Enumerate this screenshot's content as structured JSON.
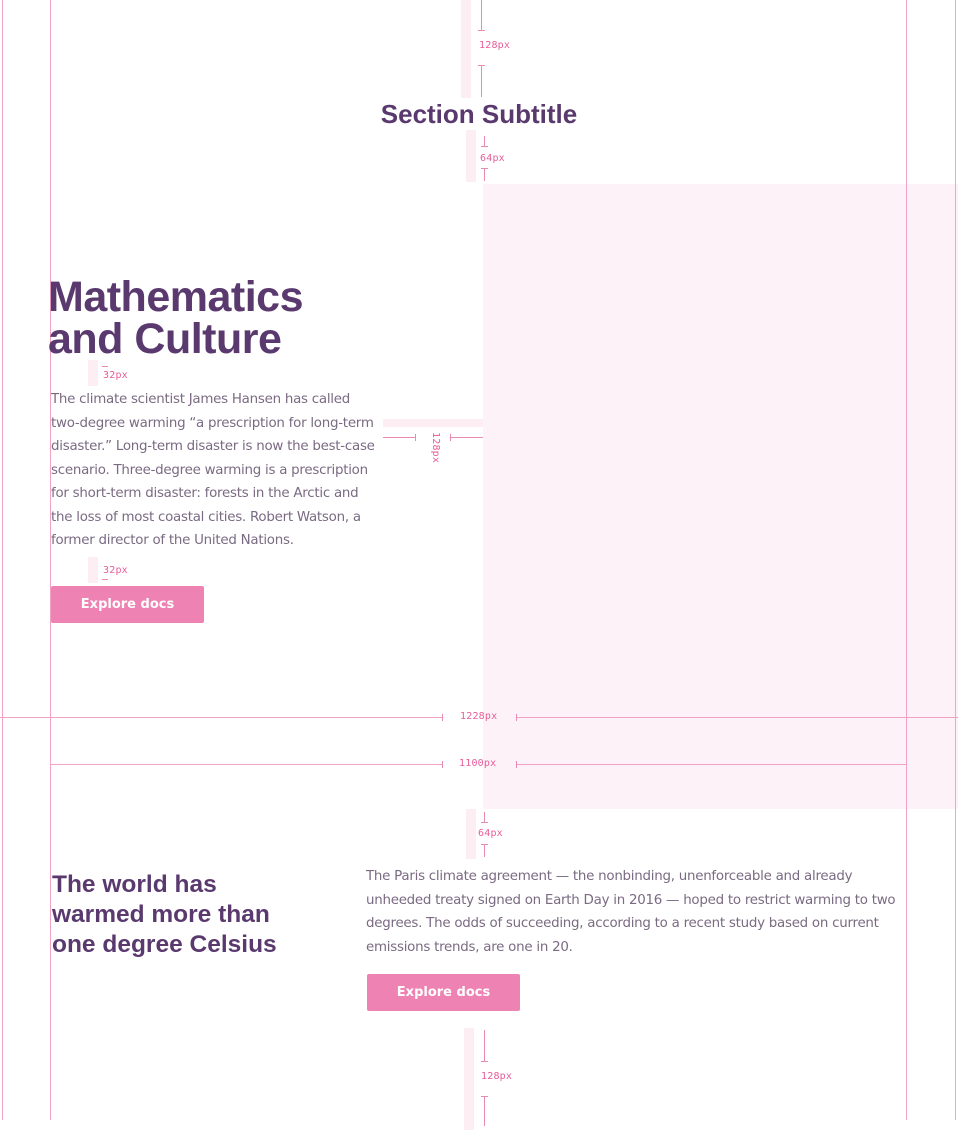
{
  "top_section": {
    "spacing_top_label": "128px",
    "subtitle": "Section Subtitle",
    "spacing_below_subtitle_label": "64px"
  },
  "hero": {
    "title_line1": "Mathematics",
    "title_line2": "and Culture",
    "spacing_after_title_label": "32px",
    "paragraph_lines": [
      "The climate scientist James Hansen has called",
      "two-degree warming “a prescription for long-term",
      "disaster.” Long-term disaster is now the best-case",
      "scenario. Three-degree warming is a prescription",
      "for short-term disaster: forests in the Arctic and",
      "the loss of most coastal cities. Robert Watson, a",
      "former director of the United Nations."
    ],
    "spacing_after_paragraph_label": "32px",
    "button_label": "Explore docs",
    "gutter_label": "128px"
  },
  "widths": {
    "outer_label": "1228px",
    "inner_label": "1100px"
  },
  "feature": {
    "spacing_top_label": "64px",
    "title_lines": [
      "The world has",
      "warmed more than",
      "one degree Celsius"
    ],
    "paragraph_lines": [
      "The Paris climate agreement — the nonbinding, unenforceable and already",
      "unheeded treaty signed on Earth Day in 2016 — hoped to restrict warming to two",
      "degrees. The odds of succeeding, according to a recent study based on current",
      "emissions trends, are one in 20."
    ],
    "button_label": "Explore docs",
    "spacing_bottom_label": "128px"
  },
  "colors": {
    "heading": "#5a3a6e",
    "body_text": "#7a6a82",
    "accent": "#ee82b2",
    "guide": "#f2a3c4",
    "placeholder": "#fdf2f7"
  }
}
